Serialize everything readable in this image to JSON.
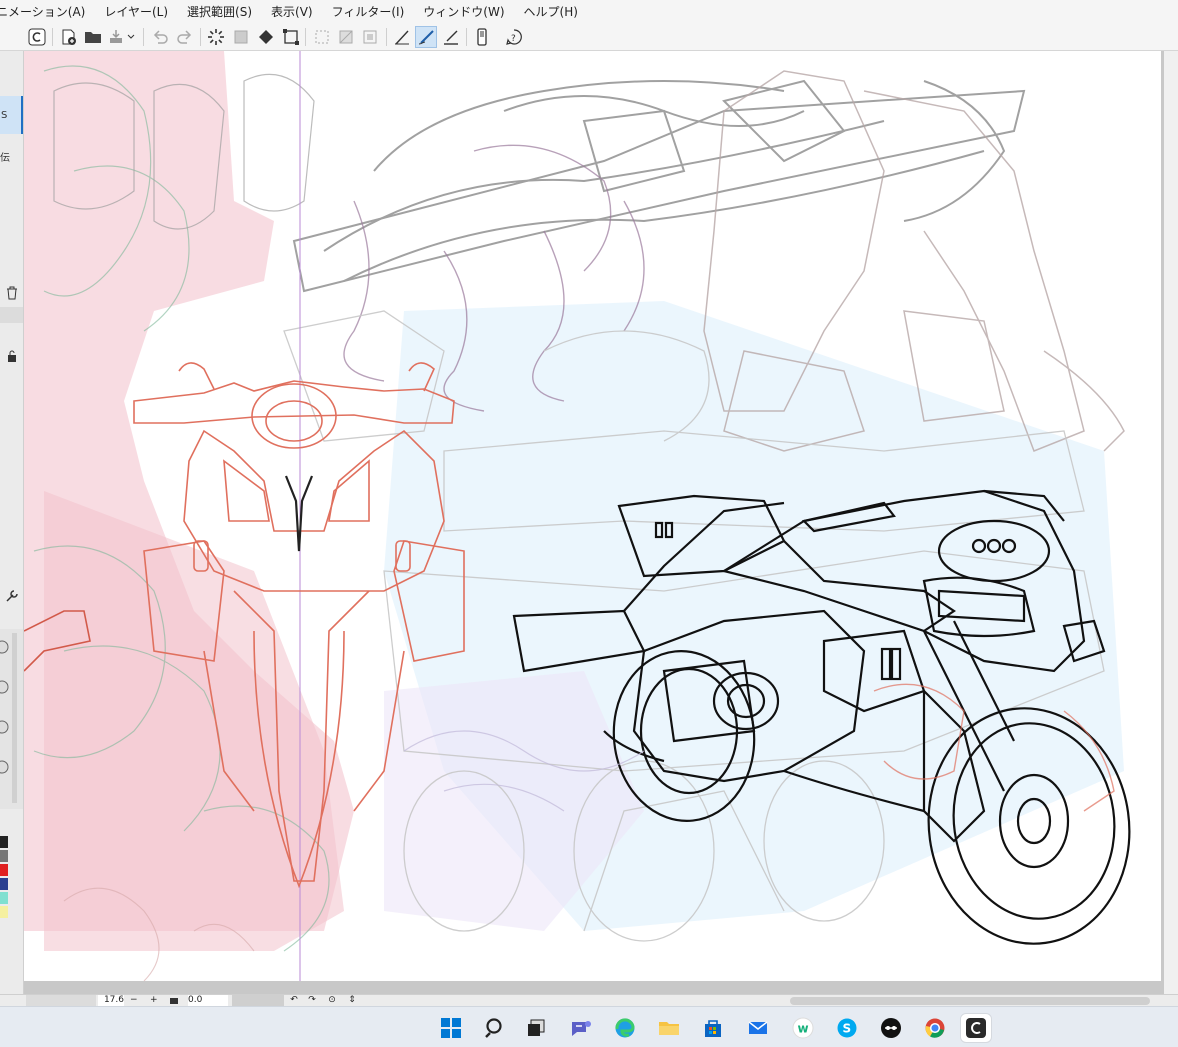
{
  "menu": {
    "items": [
      "ニメーション(A)",
      "レイヤー(L)",
      "選択範囲(S)",
      "表示(V)",
      "フィルター(I)",
      "ウィンドウ(W)",
      "ヘルプ(H)"
    ]
  },
  "toolbar": {
    "icons": [
      "app-logo-icon",
      "new-canvas-icon",
      "open-folder-icon",
      "save-icon",
      "save-dropdown-icon",
      "undo-icon",
      "redo-icon",
      "loading-icon",
      "clear-icon",
      "fill-icon",
      "transform-icon",
      "deselect-icon",
      "invert-selection-icon",
      "select-all-icon",
      "pen-line-icon",
      "brush-active-icon",
      "ruler-pen-icon",
      "smartphone-icon",
      "help-icon"
    ]
  },
  "left_panel": {
    "labels": [
      "S",
      "伝"
    ]
  },
  "status_bar": {
    "zoom_value": "17.6",
    "zoom_out": "−",
    "zoom_in": "+",
    "rotation_value": "0.0"
  },
  "taskbar": {
    "apps": [
      "windows-start",
      "search",
      "task-view",
      "teams-chat",
      "edge-browser",
      "file-explorer",
      "microsoft-store",
      "mail",
      "wps-office",
      "skype",
      "cmd-app",
      "chrome",
      "clip-studio-paint"
    ]
  },
  "colors": {
    "accent": "#0078d4",
    "sketch_red": "#e0705e",
    "sketch_gray": "#8a8a8a",
    "sketch_purple": "#9b7a9c",
    "pink_fill": "#f4c6cf",
    "guide_purple": "#b98ad6"
  }
}
